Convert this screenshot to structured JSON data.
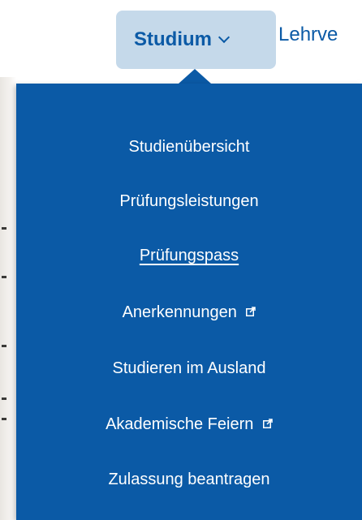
{
  "nav": {
    "active_label": "Studium",
    "next_label": "Lehrve"
  },
  "dropdown": {
    "items": [
      {
        "label": "Studienübersicht",
        "external": false,
        "current": false
      },
      {
        "label": "Prüfungsleistungen",
        "external": false,
        "current": false
      },
      {
        "label": "Prüfungspass",
        "external": false,
        "current": true
      },
      {
        "label": "Anerkennungen",
        "external": true,
        "current": false
      },
      {
        "label": "Studieren im Ausland",
        "external": false,
        "current": false
      },
      {
        "label": "Akademische Feiern",
        "external": true,
        "current": false
      },
      {
        "label": "Zulassung beantragen",
        "external": false,
        "current": false
      }
    ]
  },
  "icons": {
    "nav_chevron": "chevron-down-icon",
    "external": "external-link-icon"
  },
  "colors": {
    "brand_blue": "#0b5aa6",
    "active_bg": "#c5d9ea",
    "menu_text": "#ffffff"
  }
}
